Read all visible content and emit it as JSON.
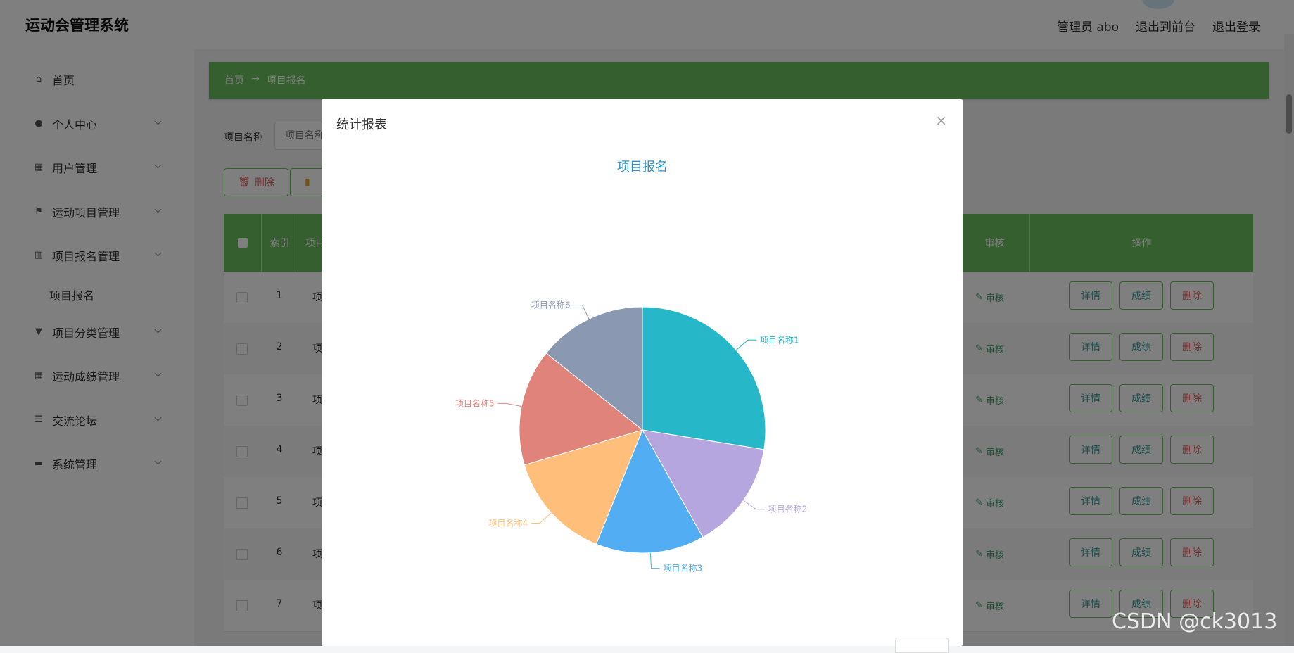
{
  "app": {
    "title": "运动会管理系统"
  },
  "header": {
    "user": "管理员 abo",
    "front": "退出到前台",
    "logout": "退出登录"
  },
  "sidebar": {
    "items": [
      {
        "label": "首页",
        "icon": "home-icon"
      },
      {
        "label": "个人中心",
        "icon": "user-icon"
      },
      {
        "label": "用户管理",
        "icon": "grid-icon"
      },
      {
        "label": "运动项目管理",
        "icon": "flag-icon"
      },
      {
        "label": "项目报名管理",
        "icon": "chart-icon"
      },
      {
        "label": "项目报名",
        "icon": ""
      },
      {
        "label": "项目分类管理",
        "icon": "pin-icon"
      },
      {
        "label": "运动成绩管理",
        "icon": "grid-icon"
      },
      {
        "label": "交流论坛",
        "icon": "list-icon"
      },
      {
        "label": "系统管理",
        "icon": "ticket-icon"
      }
    ]
  },
  "breadcrumb": {
    "home": "首页",
    "arrow": "→",
    "current": "项目报名"
  },
  "search": {
    "label": "项目名称",
    "placeholder": "项目名称"
  },
  "toolbar": {
    "delete": "删除"
  },
  "table": {
    "headers": {
      "index": "索引",
      "name": "项目",
      "audit": "审核",
      "ops": "操作"
    },
    "rows": [
      {
        "idx": "1",
        "name": "项"
      },
      {
        "idx": "2",
        "name": "项"
      },
      {
        "idx": "3",
        "name": "项"
      },
      {
        "idx": "4",
        "name": "项"
      },
      {
        "idx": "5",
        "name": "项"
      },
      {
        "idx": "6",
        "name": "项"
      },
      {
        "idx": "7",
        "name": "项"
      }
    ],
    "audit_label": "审核",
    "detail_label": "详情",
    "score_label": "成绩",
    "delete_label": "删除"
  },
  "modal": {
    "title": "统计报表",
    "close": "×"
  },
  "chart_data": {
    "type": "pie",
    "title": "项目报名",
    "slices": [
      {
        "name": "项目名称1",
        "value": 27,
        "color": "#26b7c8"
      },
      {
        "name": "项目名称2",
        "value": 14,
        "color": "#b6a6e0"
      },
      {
        "name": "项目名称3",
        "value": 14,
        "color": "#52adf2"
      },
      {
        "name": "项目名称4",
        "value": 14,
        "color": "#ffbe7a"
      },
      {
        "name": "项目名称5",
        "value": 15,
        "color": "#e0837a"
      },
      {
        "name": "项目名称6",
        "value": 14,
        "color": "#8a99b1"
      }
    ]
  },
  "colors": {
    "accent": "#6cbf5f",
    "danger": "#e05c5c",
    "teal": "#3a9a9a"
  },
  "watermark": "CSDN @ck3013"
}
